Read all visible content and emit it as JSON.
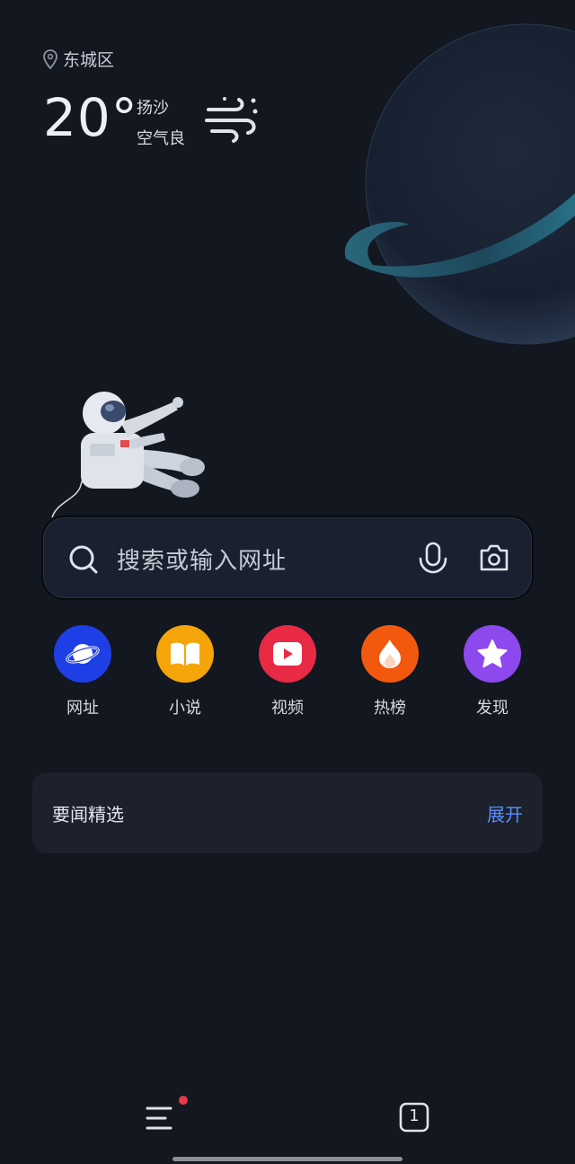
{
  "weather": {
    "location": "东城区",
    "temperature": "20°",
    "condition": "扬沙",
    "air_quality": "空气良",
    "icon": "wind-sand-icon"
  },
  "search": {
    "placeholder": "搜索或输入网址",
    "icons": [
      "search-icon",
      "microphone-icon",
      "camera-icon"
    ]
  },
  "shortcuts": [
    {
      "label": "网址",
      "icon": "planet-icon",
      "color": "#1f3fe6"
    },
    {
      "label": "小说",
      "icon": "book-icon",
      "color": "#f5a50a"
    },
    {
      "label": "视频",
      "icon": "play-icon",
      "color": "#e82a45"
    },
    {
      "label": "热榜",
      "icon": "flame-icon",
      "color": "#f2590e"
    },
    {
      "label": "发现",
      "icon": "star-icon",
      "color": "#8d48ee"
    }
  ],
  "news": {
    "title": "要闻精选",
    "action": "展开"
  },
  "bottom_bar": {
    "menu_icon": "menu-icon",
    "menu_badge": true,
    "tab_count": "1"
  }
}
